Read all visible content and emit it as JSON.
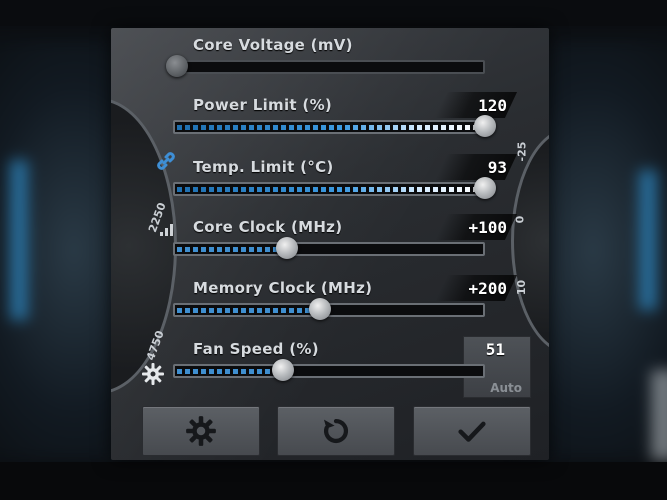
{
  "sliders": [
    {
      "id": "core-voltage",
      "label": "Core Voltage (mV)",
      "value": "",
      "fraction": 0.0,
      "state": "disabled"
    },
    {
      "id": "power-limit",
      "label": "Power Limit (%)",
      "value": "120",
      "fraction": 1.0,
      "state": "bright"
    },
    {
      "id": "temp-limit",
      "label": "Temp. Limit (°C)",
      "value": "93",
      "fraction": 1.0,
      "state": "bright"
    },
    {
      "id": "core-clock",
      "label": "Core Clock (MHz)",
      "value": "+100",
      "fraction": 0.36,
      "state": "normal"
    },
    {
      "id": "memory-clock",
      "label": "Memory Clock (MHz)",
      "value": "+200",
      "fraction": 0.46,
      "state": "normal"
    },
    {
      "id": "fan-speed",
      "label": "Fan Speed (%)",
      "value": "51",
      "fraction": 0.35,
      "state": "normal"
    }
  ],
  "fan_auto_label": "Auto",
  "left_dial_numbers": [
    "2250",
    "4750"
  ],
  "right_dial_numbers": [
    "-25",
    "0",
    "10"
  ],
  "buttons": {
    "settings": "gear-icon",
    "reset": "reset-icon",
    "apply": "checkmark-icon"
  },
  "side_icons": [
    "link-icon",
    "signal-bars-icon",
    "gear-icon"
  ],
  "colors": {
    "accent": "#3f8fd0",
    "panel": "#2a2d31",
    "text": "#d7dbdf"
  }
}
